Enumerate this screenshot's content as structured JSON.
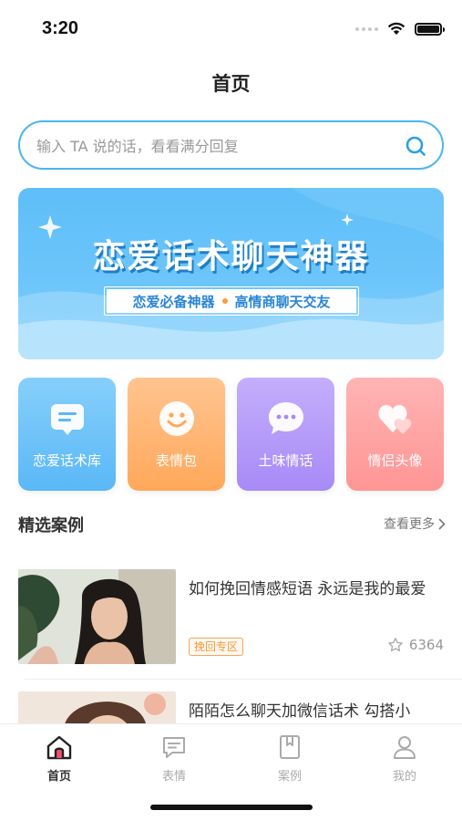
{
  "status_bar": {
    "time": "3:20"
  },
  "header": {
    "title": "首页"
  },
  "search": {
    "placeholder": "输入 TA 说的话，看看满分回复"
  },
  "banner": {
    "title": "恋爱话术聊天神器",
    "subtitle_left": "恋爱必备神器",
    "subtitle_right": "高情商聊天交友"
  },
  "categories": [
    {
      "label": "恋爱话术库",
      "icon": "chat-list-icon",
      "color": "#5ab8f6"
    },
    {
      "label": "表情包",
      "icon": "smiley-icon",
      "color": "#ffa85a"
    },
    {
      "label": "土味情话",
      "icon": "chat-bubble-dots-icon",
      "color": "#a88af6"
    },
    {
      "label": "情侣头像",
      "icon": "hearts-icon",
      "color": "#ff9595"
    }
  ],
  "featured": {
    "title": "精选案例",
    "more": "查看更多",
    "cases": [
      {
        "title": "如何挽回情感短语 永远是我的最爱",
        "tag": "挽回专区",
        "favorites": "6364"
      },
      {
        "title": "陌陌怎么聊天加微信话术 勾搭小",
        "tag": "",
        "favorites": ""
      }
    ]
  },
  "tab_bar": {
    "tabs": [
      {
        "label": "首页",
        "icon": "home-icon",
        "active": true
      },
      {
        "label": "表情",
        "icon": "message-icon",
        "active": false
      },
      {
        "label": "案例",
        "icon": "bookmark-book-icon",
        "active": false
      },
      {
        "label": "我的",
        "icon": "person-icon",
        "active": false
      }
    ]
  },
  "colors": {
    "accent": "#49b6f0",
    "tag_orange": "#f39a3a",
    "text_dark": "#333333",
    "text_muted": "#999999"
  }
}
